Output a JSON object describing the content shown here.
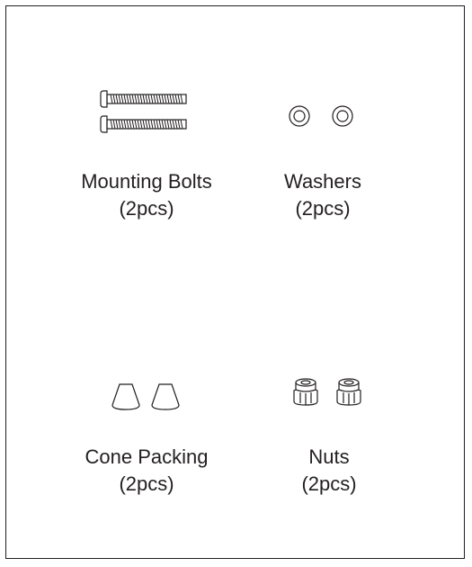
{
  "parts": [
    {
      "id": "mounting-bolts",
      "name": "Mounting Bolts",
      "qty": "(2pcs)"
    },
    {
      "id": "washers",
      "name": "Washers",
      "qty": "(2pcs)"
    },
    {
      "id": "cone-packing",
      "name": "Cone Packing",
      "qty": "(2pcs)"
    },
    {
      "id": "nuts",
      "name": "Nuts",
      "qty": "(2pcs)"
    }
  ],
  "colors": {
    "line": "#231f20",
    "background": "#ffffff"
  }
}
